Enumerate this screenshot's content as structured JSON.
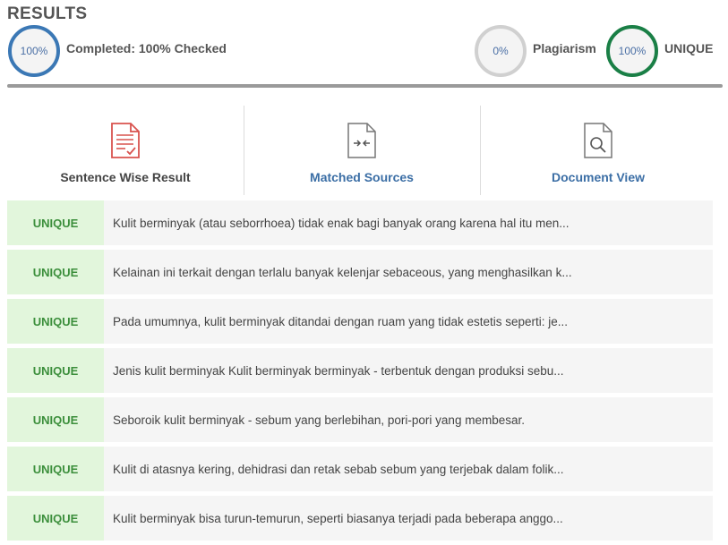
{
  "header": {
    "title": "RESULTS"
  },
  "summary": {
    "completed_percent": "100%",
    "completed_label": "Completed: 100% Checked",
    "plagiarism_percent": "0%",
    "plagiarism_label": "Plagiarism",
    "unique_percent": "100%",
    "unique_label": "UNIQUE",
    "colors": {
      "completed": "#3b78b5",
      "plagiarism": "#d0d0d0",
      "unique": "#1a7f46"
    }
  },
  "tabs": [
    {
      "label": "Sentence Wise Result",
      "icon": "document-check-icon"
    },
    {
      "label": "Matched Sources",
      "icon": "document-compare-icon"
    },
    {
      "label": "Document View",
      "icon": "document-search-icon"
    }
  ],
  "results": [
    {
      "status": "UNIQUE",
      "text": "Kulit berminyak (atau seborrhoea) tidak enak bagi banyak orang karena hal itu men..."
    },
    {
      "status": "UNIQUE",
      "text": "Kelainan ini terkait dengan terlalu banyak kelenjar sebaceous, yang menghasilkan k..."
    },
    {
      "status": "UNIQUE",
      "text": "Pada umumnya, kulit berminyak ditandai dengan ruam yang tidak estetis seperti: je..."
    },
    {
      "status": "UNIQUE",
      "text": "Jenis kulit berminyak Kulit berminyak berminyak - terbentuk dengan produksi sebu..."
    },
    {
      "status": "UNIQUE",
      "text": "Seboroik kulit berminyak - sebum yang berlebihan, pori-pori yang membesar."
    },
    {
      "status": "UNIQUE",
      "text": "Kulit di atasnya kering, dehidrasi dan retak sebab sebum yang terjebak dalam folik..."
    },
    {
      "status": "UNIQUE",
      "text": "Kulit berminyak bisa turun-temurun, seperti biasanya terjadi pada beberapa anggo..."
    }
  ]
}
